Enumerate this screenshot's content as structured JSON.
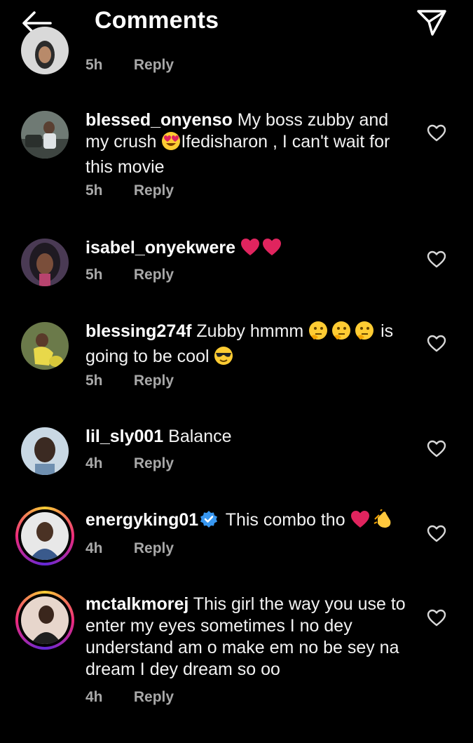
{
  "header": {
    "title": "Comments",
    "back_icon": "arrow-left-icon",
    "share_icon": "paper-plane-icon"
  },
  "comments": [
    {
      "username": "",
      "text": "",
      "time": "5h",
      "reply": "Reply"
    },
    {
      "username": "blessed_onyenso",
      "text_a": "My boss zubby and my crush ",
      "text_b": "Ifedisharon , I can't wait for this movie",
      "time": "5h",
      "reply": "Reply",
      "emoji": "heart-eyes"
    },
    {
      "username": "isabel_onyekwere",
      "text": "",
      "time": "5h",
      "reply": "Reply",
      "emoji": "two-red-hearts"
    },
    {
      "username": "blessing274f",
      "text_a": "Zubby hmmm ",
      "text_b": " is going to be cool ",
      "time": "5h",
      "reply": "Reply",
      "emoji": "thinking-faces, sunglasses"
    },
    {
      "username": "lil_sly001",
      "text": "Balance",
      "time": "4h",
      "reply": "Reply"
    },
    {
      "username": "energyking01",
      "text": "This combo tho ",
      "time": "4h",
      "reply": "Reply",
      "verified": true,
      "emoji": "red-heart, clapping-hands"
    },
    {
      "username": "mctalkmorej",
      "text": "This girl the way you use to enter my eyes sometimes I no dey understand am o make em no be sey na dream I dey dream so oo",
      "time": "4h",
      "reply": "Reply"
    }
  ],
  "colors": {
    "background": "#000000",
    "text": "#f2f2f2",
    "meta": "#a8a8a8",
    "verified": "#3897f0",
    "heart_emoji": "#e0245e"
  }
}
